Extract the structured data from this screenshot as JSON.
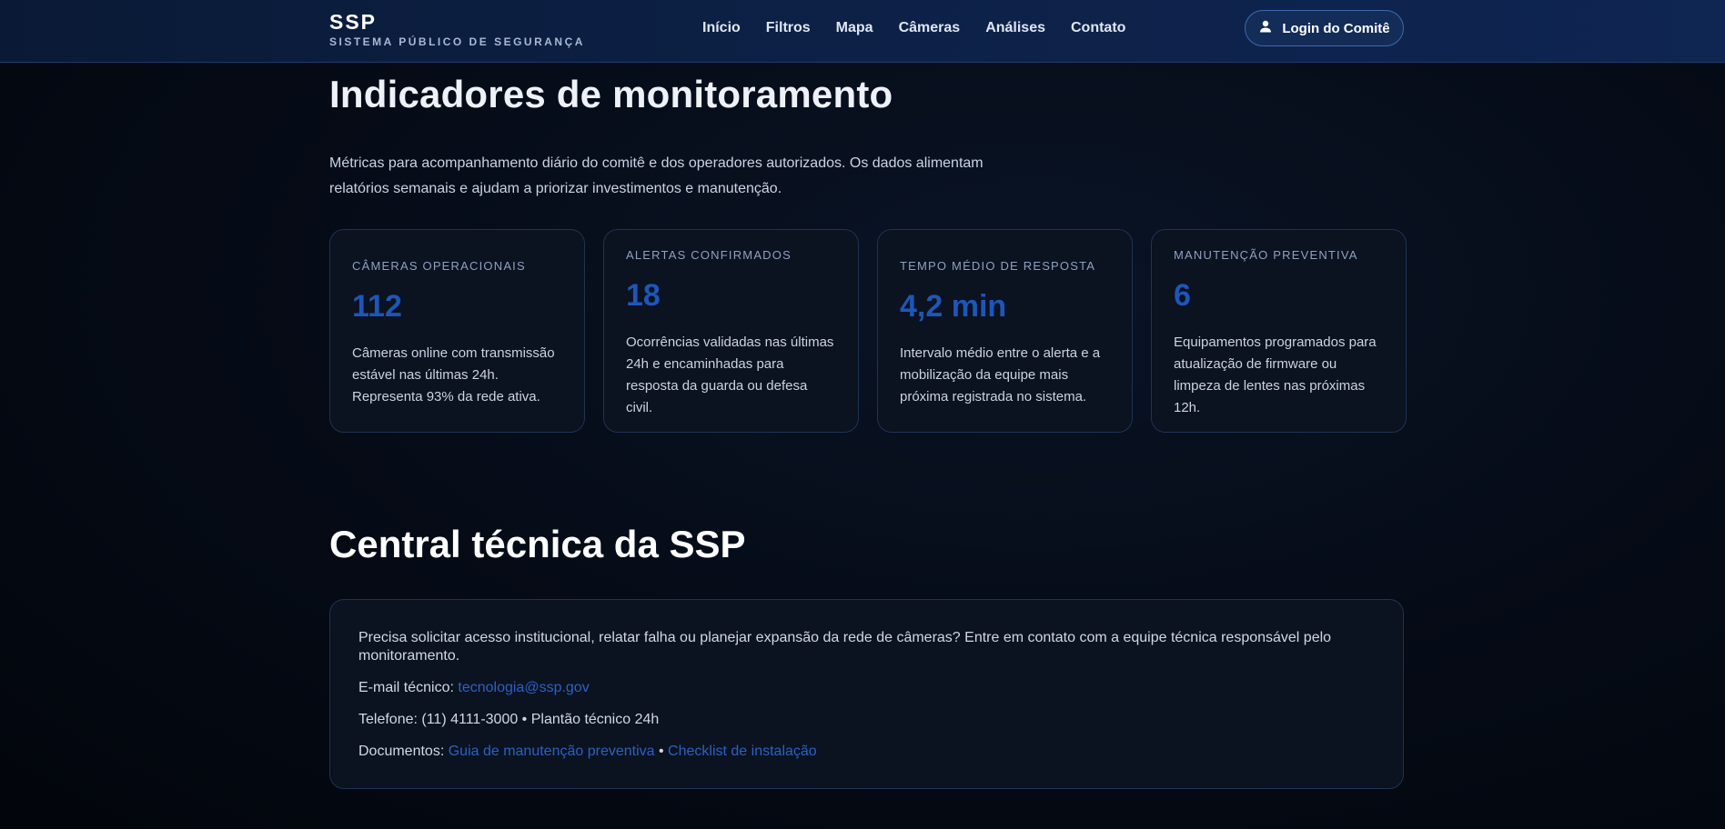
{
  "header": {
    "brand_name": "SSP",
    "brand_sub": "SISTEMA PÚBLICO DE SEGURANÇA",
    "nav": [
      "Início",
      "Filtros",
      "Mapa",
      "Câmeras",
      "Análises",
      "Contato"
    ],
    "login_label": "Login do Comitê",
    "login_icon": "user-icon"
  },
  "indicators": {
    "title": "Indicadores de monitoramento",
    "intro": "Métricas para acompanhamento diário do comitê e dos operadores autorizados. Os dados alimentam relatórios semanais e ajudam a priorizar investimentos e manutenção.",
    "cards": [
      {
        "label": "Câmeras operacionais",
        "value": "112",
        "desc": "Câmeras online com transmissão estável nas últimas 24h. Representa 93% da rede ativa."
      },
      {
        "label": "Alertas confirmados",
        "value": "18",
        "desc": "Ocorrências validadas nas últimas 24h e encaminhadas para resposta da guarda ou defesa civil."
      },
      {
        "label": "Tempo médio de resposta",
        "value": "4,2 min",
        "desc": "Intervalo médio entre o alerta e a mobilização da equipe mais próxima registrada no sistema."
      },
      {
        "label": "Manutenção preventiva",
        "value": "6",
        "desc": "Equipamentos programados para atualização de firmware ou limpeza de lentes nas próximas 12h."
      }
    ]
  },
  "central": {
    "title": "Central técnica da SSP",
    "intro": "Precisa solicitar acesso institucional, relatar falha ou planejar expansão da rede de câmeras? Entre em contato com a equipe técnica responsável pelo monitoramento.",
    "email_label": "E-mail técnico:",
    "email": "tecnologia@ssp.gov",
    "phone_line": "Telefone: (11) 4111-3000 • Plantão técnico 24h",
    "docs_label": "Documentos:",
    "doc_1": "Guia de manutenção preventiva",
    "doc_sep": "•",
    "doc_2": "Checklist de instalação"
  },
  "colors": {
    "accent": "#1e56b8",
    "link": "#2a62c2",
    "header_bg": "#0d2147",
    "page_bg": "#050a14"
  }
}
